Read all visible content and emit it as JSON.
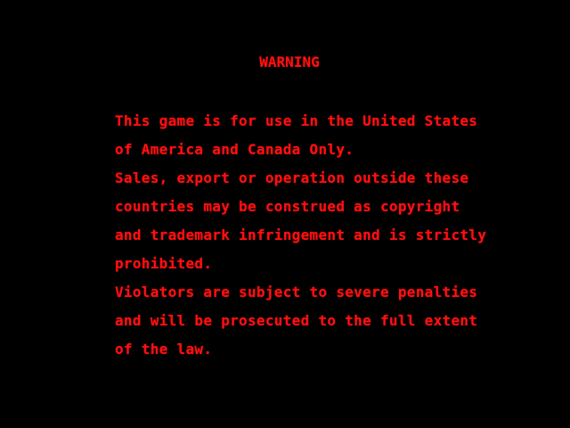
{
  "warning": {
    "title": "WARNING",
    "lines": [
      "This game is for use in the United States",
      "of America and Canada Only.",
      "Sales, export or operation outside these",
      "countries may be construed as copyright",
      "and trademark infringement and is strictly",
      "prohibited.",
      "Violators are subject to severe penalties",
      "and will be prosecuted to the full extent",
      "of the law."
    ]
  },
  "colors": {
    "background": "#000000",
    "text": "#ff1010"
  }
}
